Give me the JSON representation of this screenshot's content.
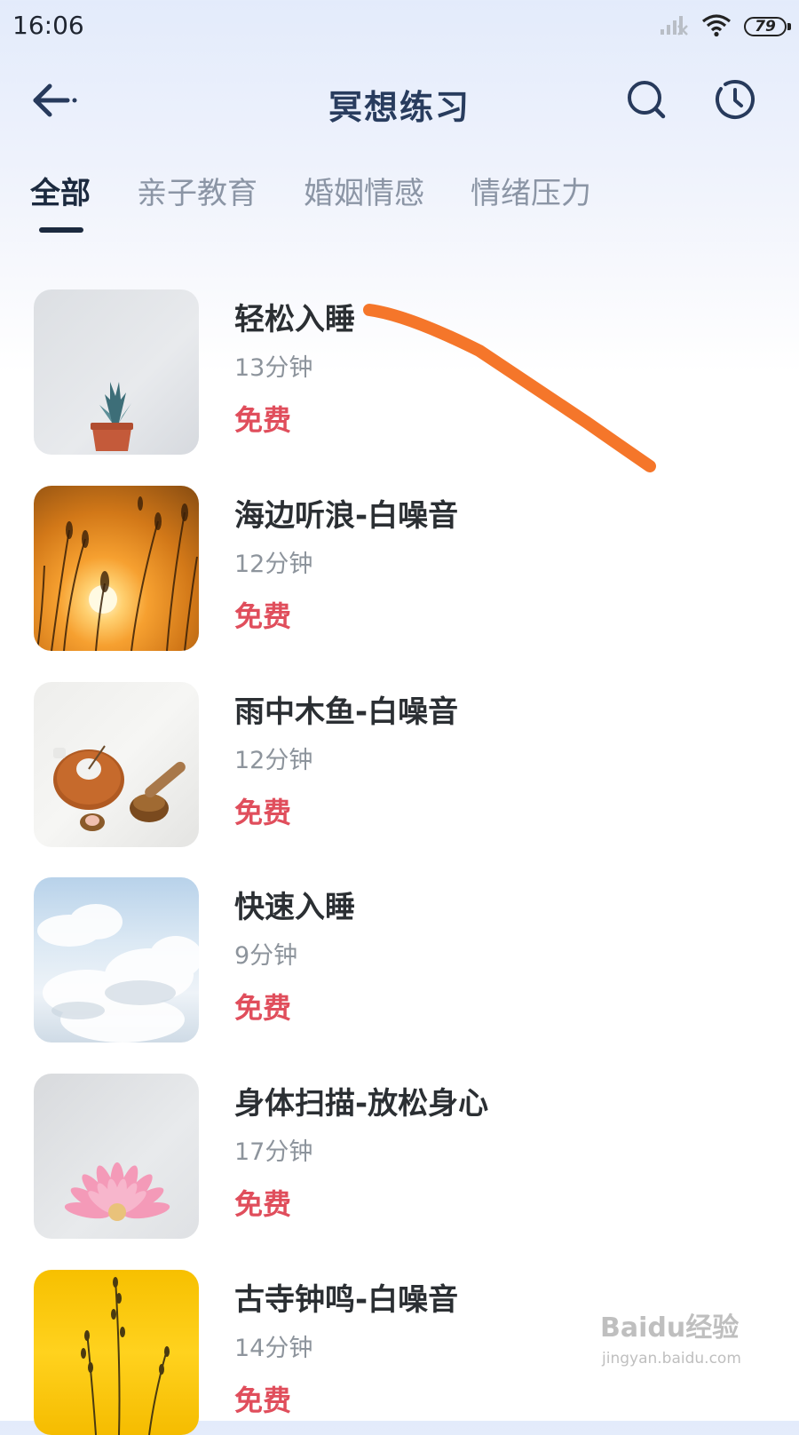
{
  "status_bar": {
    "time": "16:06",
    "battery": "79",
    "icons": [
      "signal-icon",
      "wifi-icon",
      "battery-icon"
    ]
  },
  "header": {
    "title": "冥想练习",
    "back_icon": "back-arrow-icon",
    "search_icon": "search-icon",
    "history_icon": "clock-icon"
  },
  "tabs": [
    {
      "label": "全部",
      "active": true
    },
    {
      "label": "亲子教育",
      "active": false
    },
    {
      "label": "婚姻情感",
      "active": false
    },
    {
      "label": "情绪压力",
      "active": false
    }
  ],
  "items": [
    {
      "title": "轻松入睡",
      "duration": "13分钟",
      "price": "免费",
      "image": "potted-succulent"
    },
    {
      "title": "海边听浪-白噪音",
      "duration": "12分钟",
      "price": "免费",
      "image": "sunset-grass"
    },
    {
      "title": "雨中木鱼-白噪音",
      "duration": "12分钟",
      "price": "免费",
      "image": "incense-and-bowl"
    },
    {
      "title": "快速入睡",
      "duration": "9分钟",
      "price": "免费",
      "image": "clouds-sky"
    },
    {
      "title": "身体扫描-放松身心",
      "duration": "17分钟",
      "price": "免费",
      "image": "pink-gerbera-flower"
    },
    {
      "title": "古寺钟鸣-白噪音",
      "duration": "14分钟",
      "price": "免费",
      "image": "dry-grass-yellow"
    }
  ],
  "watermark": {
    "brand": "Baidu经验",
    "url": "jingyan.baidu.com"
  },
  "colors": {
    "accent_title": "#283c5e",
    "price_red": "#e04e5c",
    "annotation_orange": "#f5762a"
  }
}
